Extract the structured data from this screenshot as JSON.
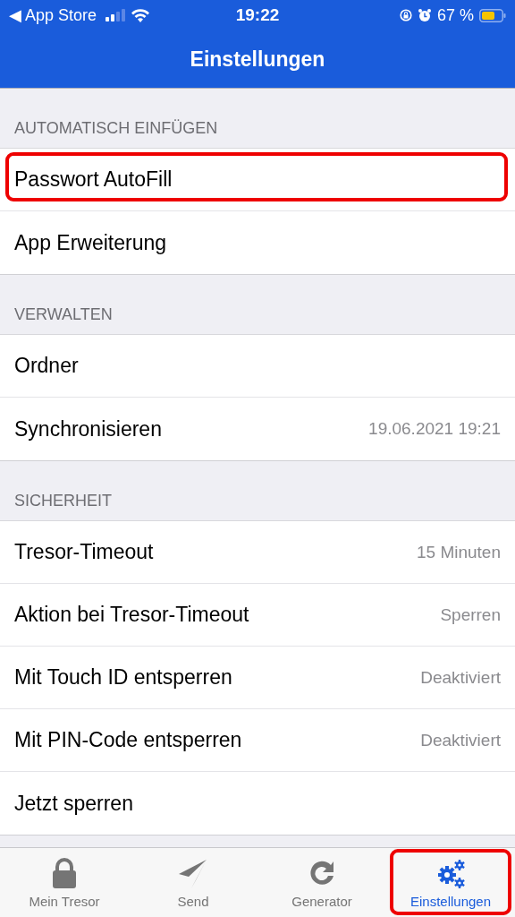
{
  "status_bar": {
    "back_label": "◀ App Store",
    "time": "19:22",
    "battery_text": "67 %"
  },
  "nav_bar": {
    "title": "Einstellungen"
  },
  "sections": [
    {
      "header": "AUTOMATISCH EINFÜGEN",
      "rows": [
        {
          "label": "Passwort AutoFill",
          "highlighted": true
        },
        {
          "label": "App Erweiterung",
          "highlighted": false
        }
      ]
    },
    {
      "header": "VERWALTEN",
      "rows": [
        {
          "label": "Ordner",
          "highlighted": false
        },
        {
          "label": "Synchronisieren",
          "value": "19.06.2021 19:21",
          "highlighted": false
        }
      ]
    },
    {
      "header": "SICHERHEIT",
      "rows": [
        {
          "label": "Tresor-Timeout",
          "value": "15 Minuten",
          "highlighted": false
        },
        {
          "label": "Aktion bei Tresor-Timeout",
          "value": "Sperren",
          "highlighted": false
        },
        {
          "label": "Mit Touch ID entsperren",
          "value": "Deaktiviert",
          "highlighted": false
        },
        {
          "label": "Mit PIN-Code entsperren",
          "value": "Deaktiviert",
          "highlighted": false
        },
        {
          "label": "Jetzt sperren",
          "highlighted": false
        }
      ]
    }
  ],
  "tab_bar": [
    {
      "kind": "lock",
      "label": "Mein Tresor",
      "selected": false,
      "highlighted": false
    },
    {
      "kind": "send",
      "label": "Send",
      "selected": false,
      "highlighted": false
    },
    {
      "kind": "generator",
      "label": "Generator",
      "selected": false,
      "highlighted": false
    },
    {
      "kind": "settings",
      "label": "Einstellungen",
      "selected": true,
      "highlighted": true
    }
  ]
}
